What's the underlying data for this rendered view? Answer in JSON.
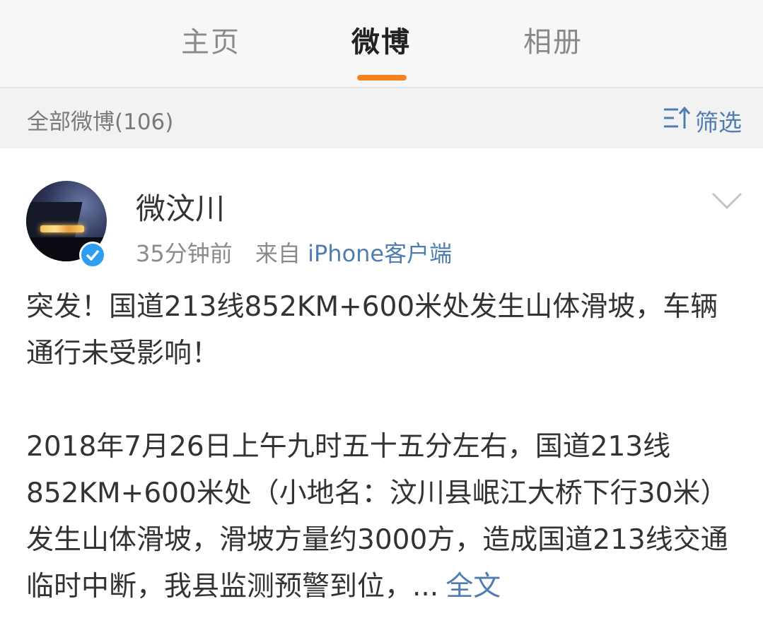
{
  "tabs": [
    {
      "label": "主页"
    },
    {
      "label": "微博"
    },
    {
      "label": "相册"
    }
  ],
  "colors": {
    "accent": "#f5821f",
    "link": "#507daf",
    "verified": "#2e9ef0"
  },
  "filter_bar": {
    "all_label": "全部微博(106)",
    "filter_label": "筛选",
    "filter_icon": "filter-icon"
  },
  "post": {
    "username": "微汶川",
    "time": "35分钟前",
    "source_prefix": "来自",
    "source_client": "iPhone客户端",
    "paragraph1": "突发！国道213线852KM+600米处发生山体滑坡，车辆通行未受影响！",
    "paragraph2": "2018年7月26日上午九时五十五分左右，国道213线852KM+600米处（小地名：汶川县岷江大桥下行30米）发生山体滑坡，滑坡方量约3000方，造成国道213线交通临时中断，我县监测预警到位，...",
    "full_text_link": "全文"
  }
}
